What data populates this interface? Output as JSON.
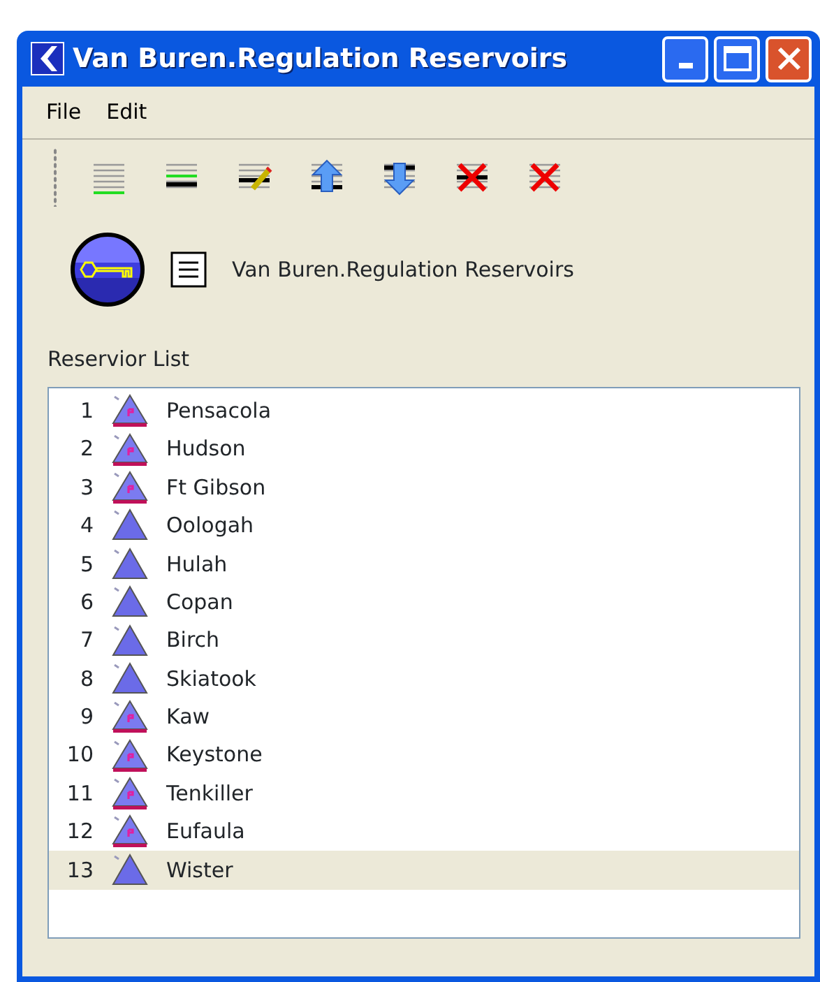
{
  "window": {
    "title": "Van Buren.Regulation Reservoirs"
  },
  "menu": [
    {
      "label": "File"
    },
    {
      "label": "Edit"
    }
  ],
  "header": {
    "name": "Van Buren.Regulation Reservoirs"
  },
  "list": {
    "label": "Reservior List",
    "rows": [
      {
        "number": "1",
        "name": "Pensacola",
        "kind": "marked",
        "selected": false
      },
      {
        "number": "2",
        "name": "Hudson",
        "kind": "marked",
        "selected": false
      },
      {
        "number": "3",
        "name": "Ft Gibson",
        "kind": "marked",
        "selected": false
      },
      {
        "number": "4",
        "name": "Oologah",
        "kind": "plain",
        "selected": false
      },
      {
        "number": "5",
        "name": "Hulah",
        "kind": "plain",
        "selected": false
      },
      {
        "number": "6",
        "name": "Copan",
        "kind": "plain",
        "selected": false
      },
      {
        "number": "7",
        "name": "Birch",
        "kind": "plain",
        "selected": false
      },
      {
        "number": "8",
        "name": "Skiatook",
        "kind": "plain",
        "selected": false
      },
      {
        "number": "9",
        "name": "Kaw",
        "kind": "marked",
        "selected": false
      },
      {
        "number": "10",
        "name": "Keystone",
        "kind": "marked",
        "selected": false
      },
      {
        "number": "11",
        "name": "Tenkiller",
        "kind": "marked",
        "selected": false
      },
      {
        "number": "12",
        "name": "Eufaula",
        "kind": "marked",
        "selected": false
      },
      {
        "number": "13",
        "name": "Wister",
        "kind": "plain",
        "selected": true
      }
    ]
  }
}
